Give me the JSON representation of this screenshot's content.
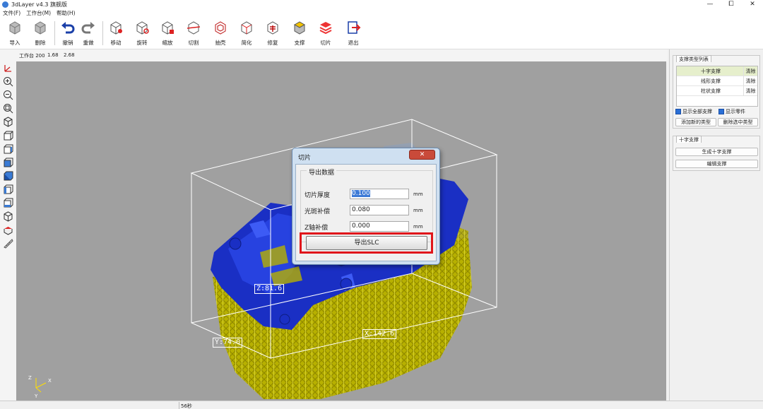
{
  "window": {
    "title": "3dLayer v4.3 旗舰版",
    "controls": [
      "—",
      "⧠",
      "✕"
    ]
  },
  "menu": [
    "文件(F)",
    "工作台(M)",
    "帮助(H)"
  ],
  "toolbar": [
    {
      "id": "import",
      "label": "导入",
      "icon": "cube-import-icon"
    },
    {
      "id": "delete",
      "label": "删除",
      "icon": "cube-delete-icon"
    },
    {
      "id": "undo",
      "label": "撤销",
      "icon": "undo-icon"
    },
    {
      "id": "redo",
      "label": "重做",
      "icon": "redo-icon"
    },
    {
      "id": "move",
      "label": "移动",
      "icon": "cube-move-icon"
    },
    {
      "id": "rotate",
      "label": "旋转",
      "icon": "cube-rotate-icon"
    },
    {
      "id": "scale",
      "label": "缩放",
      "icon": "cube-scale-icon"
    },
    {
      "id": "cut",
      "label": "切割",
      "icon": "cube-cut-icon"
    },
    {
      "id": "hollow",
      "label": "抽壳",
      "icon": "cube-hollow-icon"
    },
    {
      "id": "simplify",
      "label": "简化",
      "icon": "cube-simplify-icon"
    },
    {
      "id": "repair",
      "label": "修复",
      "icon": "cube-repair-icon"
    },
    {
      "id": "support",
      "label": "支撑",
      "icon": "support-icon"
    },
    {
      "id": "slice",
      "label": "切片",
      "icon": "slice-icon"
    },
    {
      "id": "exit",
      "label": "退出",
      "icon": "exit-icon"
    }
  ],
  "subbar": {
    "workbench": "工作台 200",
    "v1": "1.68",
    "v2": "2.68"
  },
  "dimensions": {
    "z": "Z:81.6",
    "y": "Y:74.0",
    "x": "X:142.6"
  },
  "axis_labels": {
    "z": "Z",
    "x": "X",
    "y": "Y"
  },
  "right_panel": {
    "support_types_tab": "支撑类型列表",
    "support_types": [
      {
        "name": "十字支撑",
        "action": "清除",
        "selected": true
      },
      {
        "name": "线形支撑",
        "action": "清除",
        "selected": false
      },
      {
        "name": "柱状支撑",
        "action": "清除",
        "selected": false
      }
    ],
    "show_all_supports": "显示全部支撑",
    "show_parts": "显示零件",
    "add_type_button": "添加新的类型",
    "delete_type_button": "删除选中类型",
    "cross_support_tab": "十字支撑",
    "generate_button": "生成十字支撑",
    "edit_button": "编辑支撑"
  },
  "dialog": {
    "title": "切片",
    "close_label": "✕",
    "group_title": "导出数据",
    "fields": [
      {
        "label": "切片厚度",
        "value": "0.100",
        "unit": "mm"
      },
      {
        "label": "光斑补偿",
        "value": "0.080",
        "unit": "mm"
      },
      {
        "label": "Z轴补偿",
        "value": "0.000",
        "unit": "mm"
      }
    ],
    "export_button": "导出SLC"
  },
  "status": {
    "time": "56秒"
  },
  "colors": {
    "model": "#1a2fc4",
    "supports": "#b7b000",
    "viewport": "#a0a0a0",
    "highlight": "#e0161b"
  }
}
